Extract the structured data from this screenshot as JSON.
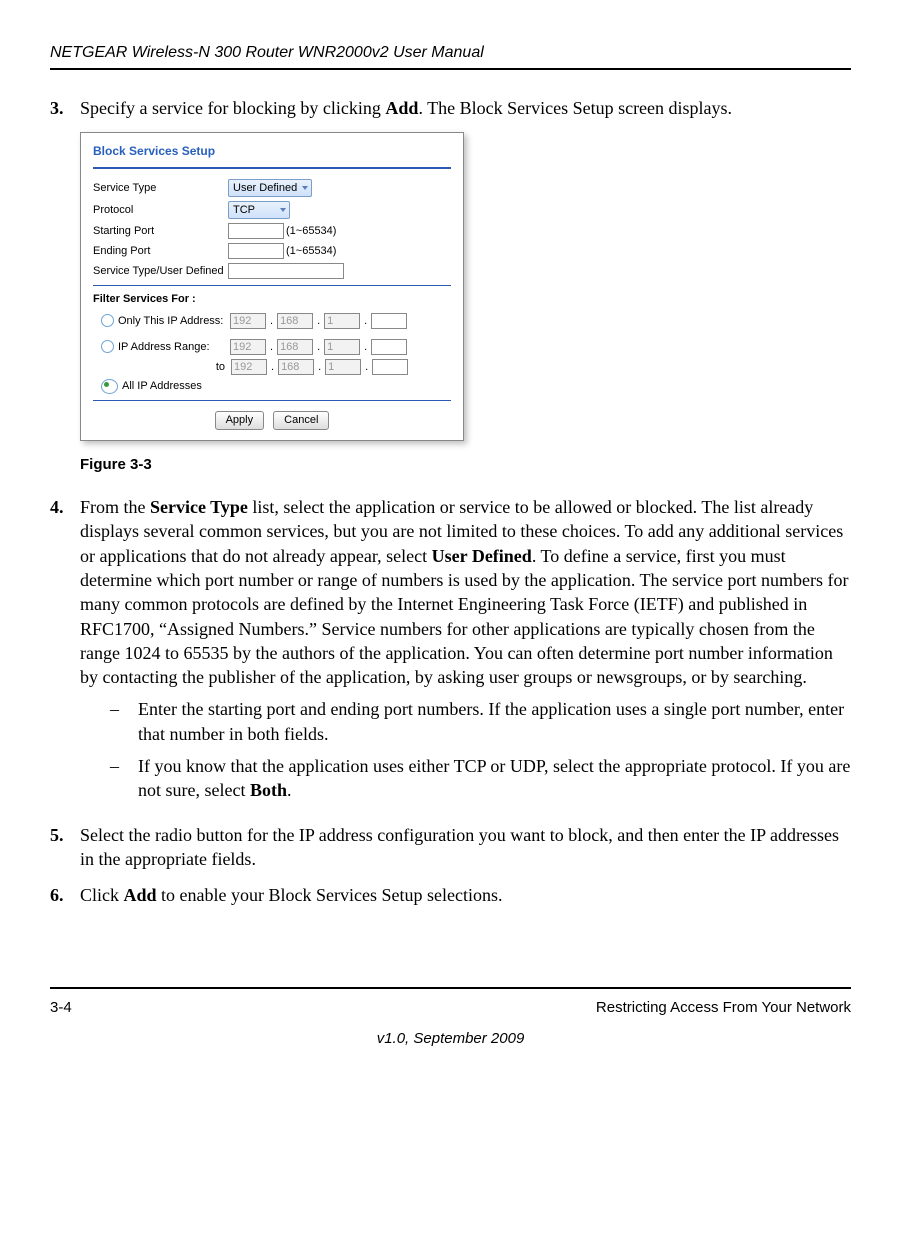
{
  "header": {
    "title": "NETGEAR Wireless-N 300 Router WNR2000v2 User Manual"
  },
  "steps": {
    "s3": {
      "num": "3.",
      "pre": "Specify a service for blocking by clicking ",
      "bold": "Add",
      "post": ". The Block Services Setup screen displays."
    },
    "s4": {
      "num": "4.",
      "pre": "From the ",
      "b1": "Service Type",
      "mid1": " list, select the application or service to be allowed or blocked. The list already displays several common services, but you are not limited to these choices. To add any additional services or applications that do not already appear, select ",
      "b2": "User Defined",
      "mid2": ". To define a service, first you must determine which port number or range of numbers is used by the application. The service port numbers for many common protocols are defined by the Internet Engineering Task Force (IETF) and published in RFC1700, “Assigned Numbers.” Service numbers for other applications are typically chosen from the range 1024 to 65535 by the authors of the application. You can often determine port number information by contacting the publisher of the application, by asking user groups or newsgroups, or by searching.",
      "sub1": "Enter the starting port and ending port numbers. If the application uses a single port number, enter that number in both fields.",
      "sub2_pre": "If you know that the application uses either TCP or UDP, select the appropriate protocol. If you are not sure, select ",
      "sub2_bold": "Both",
      "sub2_post": "."
    },
    "s5": {
      "num": "5.",
      "text": "Select the radio button for the IP address configuration you want to block, and then enter the IP addresses in the appropriate fields."
    },
    "s6": {
      "num": "6.",
      "pre": "Click ",
      "bold": "Add",
      "post": " to enable your Block Services Setup selections."
    }
  },
  "figure": {
    "caption": "Figure 3-3",
    "title": "Block Services Setup",
    "rows": {
      "serviceType": {
        "label": "Service Type",
        "value": "User Defined"
      },
      "protocol": {
        "label": "Protocol",
        "value": "TCP"
      },
      "startPort": {
        "label": "Starting Port",
        "hint": "(1~65534)"
      },
      "endPort": {
        "label": "Ending Port",
        "hint": "(1~65534)"
      },
      "userDef": {
        "label": "Service Type/User Defined"
      }
    },
    "filterLabel": "Filter Services For :",
    "radios": {
      "only": "Only This IP Address:",
      "range": "IP Address Range:",
      "to": "to",
      "all": "All IP Addresses"
    },
    "ip": {
      "a": "192",
      "b": "168",
      "c": "1"
    },
    "buttons": {
      "apply": "Apply",
      "cancel": "Cancel"
    }
  },
  "footer": {
    "page": "3-4",
    "section": "Restricting Access From Your Network",
    "version": "v1.0, September 2009"
  },
  "dash": "–"
}
